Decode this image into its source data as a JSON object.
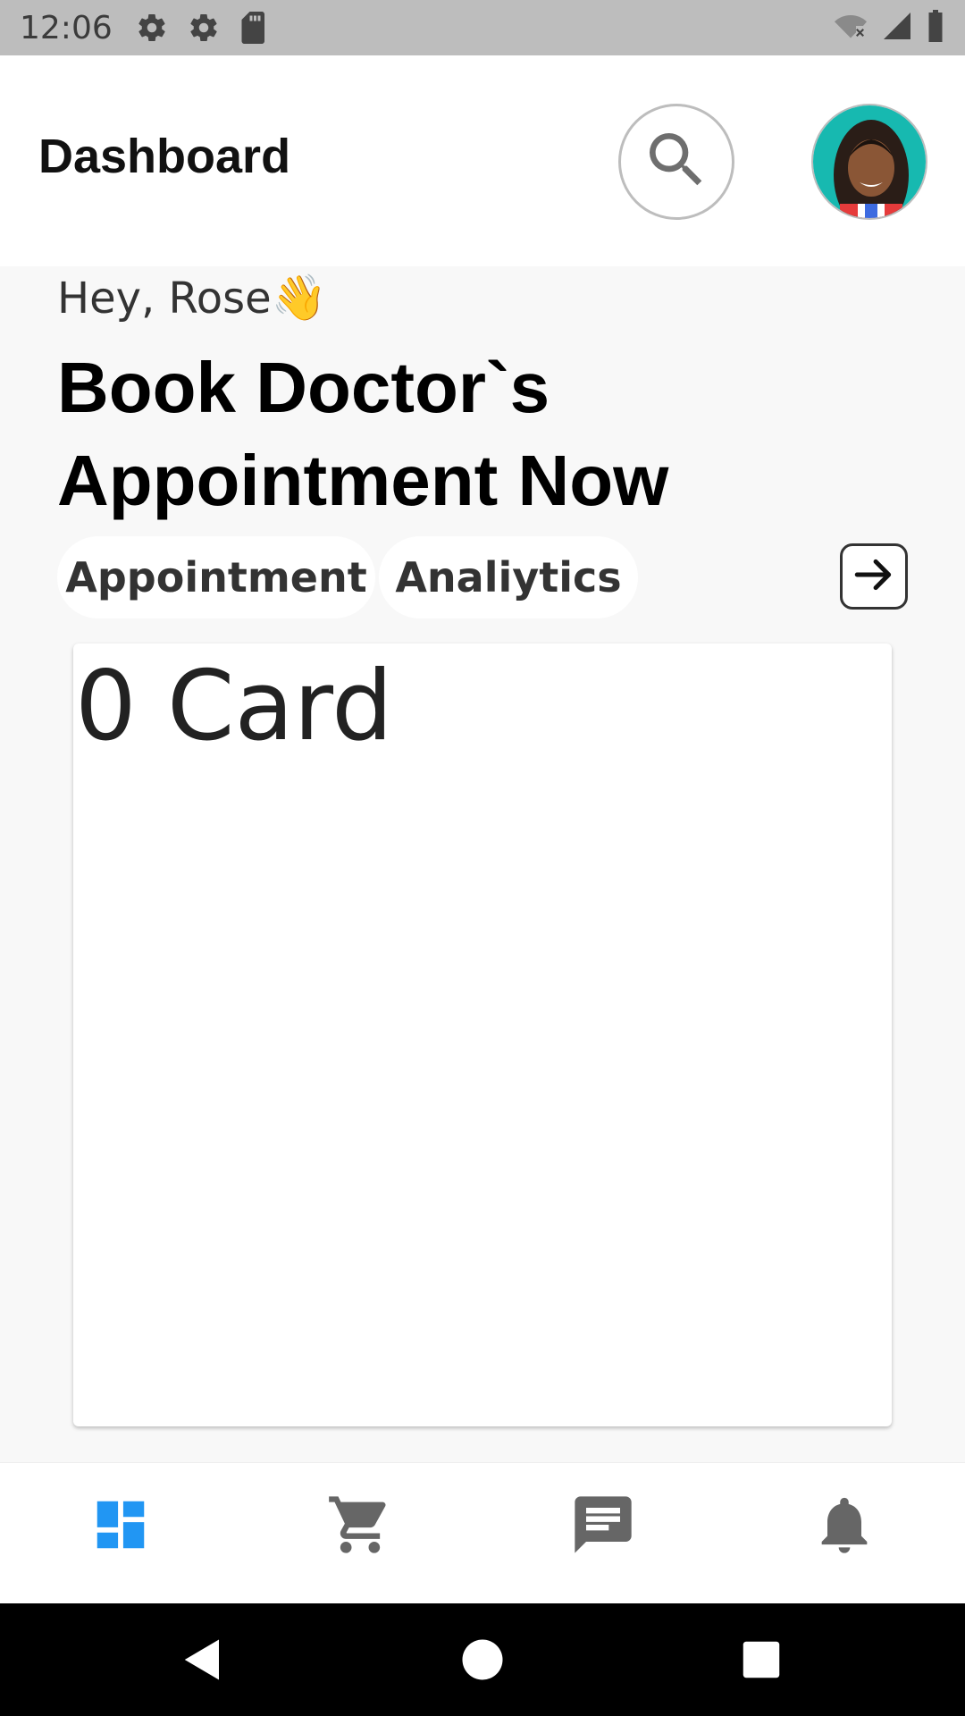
{
  "status_bar": {
    "time": "12:06",
    "left_icons": [
      "gear-icon",
      "gear-icon",
      "sd-card-icon"
    ],
    "right_icons": [
      "wifi-off-icon",
      "signal-icon",
      "battery-icon"
    ],
    "background": "#bdbdbd"
  },
  "header": {
    "title": "Dashboard",
    "search_icon": "search-icon",
    "avatar": "user-avatar"
  },
  "main": {
    "greeting": "Hey, Rose",
    "greeting_emoji": "👋",
    "headline_line1": "Book Doctor`s",
    "headline_line2": "Appointment Now",
    "chips": [
      {
        "label": "Appointment"
      },
      {
        "label": "Analiytics"
      }
    ],
    "arrow_icon": "arrow-right-icon",
    "card_text": "0 Card"
  },
  "bottom_nav": {
    "items": [
      {
        "icon": "dashboard-icon",
        "active": true
      },
      {
        "icon": "cart-icon",
        "active": false
      },
      {
        "icon": "message-icon",
        "active": false
      },
      {
        "icon": "bell-icon",
        "active": false
      }
    ],
    "active_color": "#2196f3",
    "inactive_color": "#666666"
  },
  "system_nav": {
    "icons": [
      "back-icon",
      "home-icon",
      "recents-icon"
    ]
  }
}
